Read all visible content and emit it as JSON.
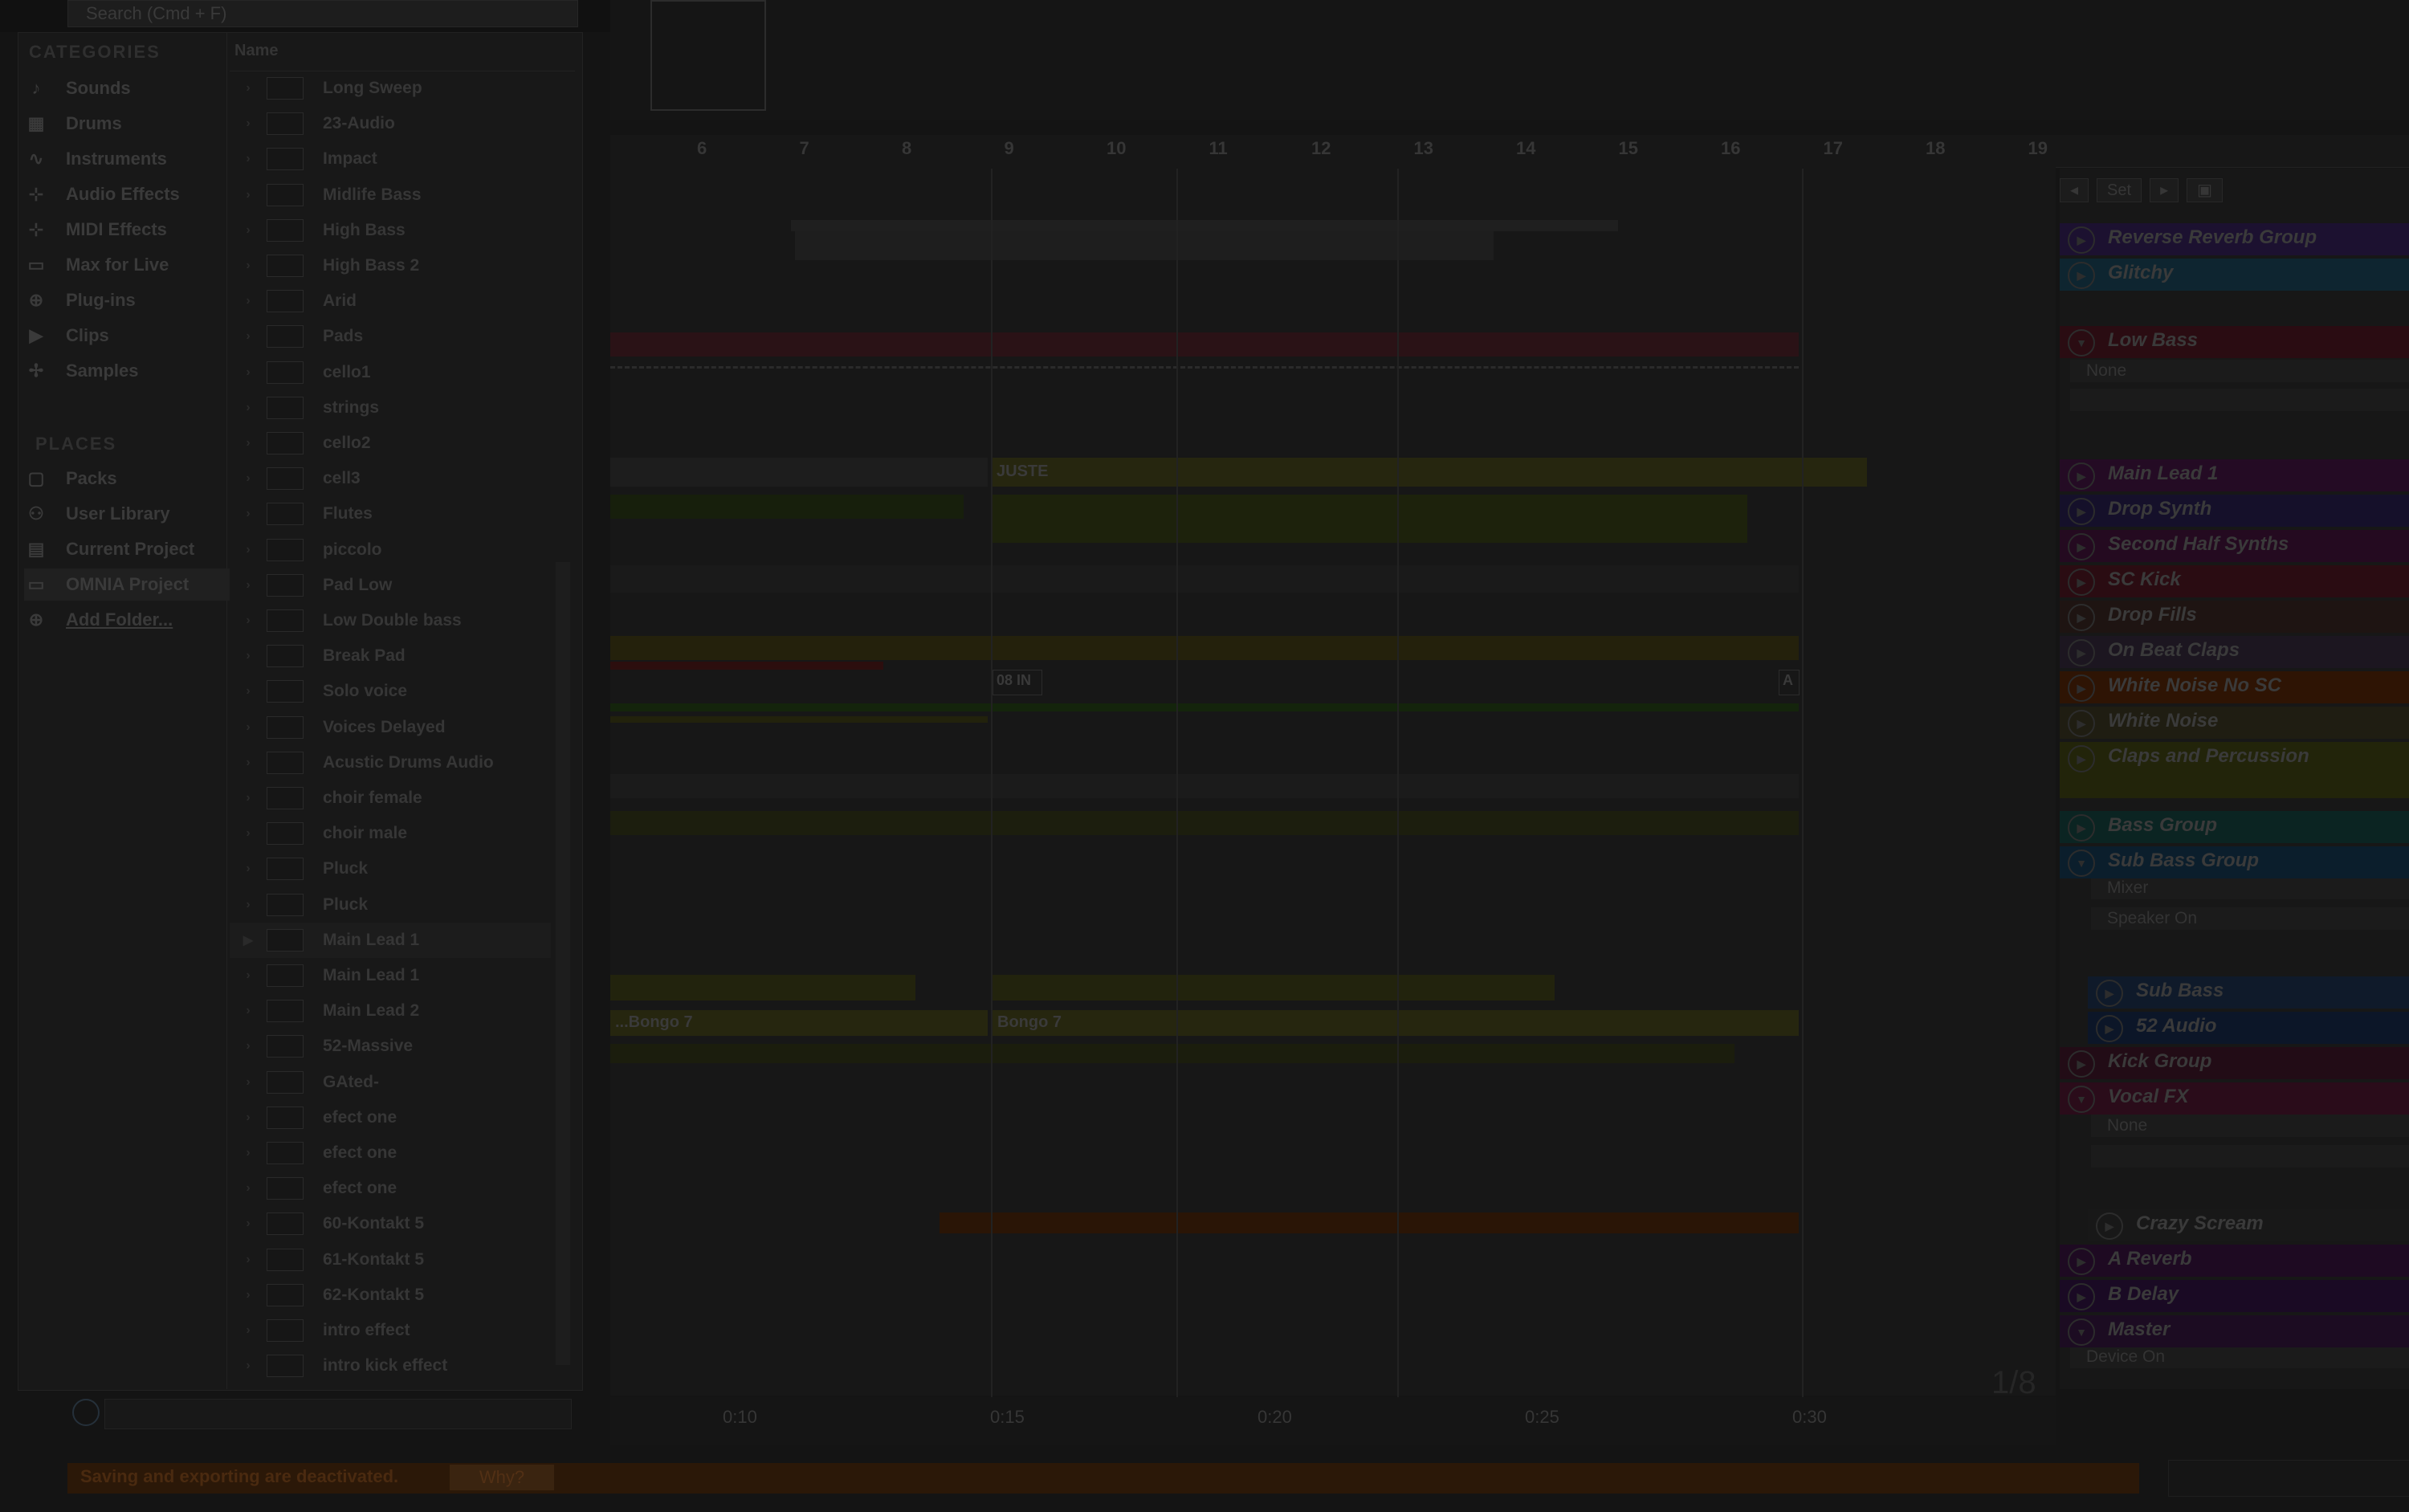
{
  "search": {
    "placeholder": "Search (Cmd + F)"
  },
  "browser": {
    "categories_title": "CATEGORIES",
    "categories": [
      {
        "label": "Sounds",
        "icon": "note-icon"
      },
      {
        "label": "Drums",
        "icon": "grid-icon"
      },
      {
        "label": "Instruments",
        "icon": "instrument-icon"
      },
      {
        "label": "Audio Effects",
        "icon": "audio-fx-icon"
      },
      {
        "label": "MIDI Effects",
        "icon": "midi-fx-icon"
      },
      {
        "label": "Max for Live",
        "icon": "max-icon"
      },
      {
        "label": "Plug-ins",
        "icon": "plugin-icon"
      },
      {
        "label": "Clips",
        "icon": "clip-icon"
      },
      {
        "label": "Samples",
        "icon": "sample-icon"
      }
    ],
    "places_title": "PLACES",
    "places": [
      {
        "label": "Packs",
        "icon": "packs-icon"
      },
      {
        "label": "User Library",
        "icon": "user-icon"
      },
      {
        "label": "Current Project",
        "icon": "project-icon"
      },
      {
        "label": "OMNIA Project",
        "icon": "folder-icon"
      },
      {
        "label": "Add Folder...",
        "icon": "add-icon"
      }
    ],
    "name_header": "Name",
    "files": [
      "Long Sweep",
      "23-Audio",
      "Impact",
      "Midlife Bass",
      "High Bass",
      "High Bass 2",
      "Arid",
      "Pads",
      "cello1",
      "strings",
      "cello2",
      "cell3",
      "Flutes",
      "piccolo",
      "Pad Low",
      "Low Double bass",
      "Break Pad",
      "Solo voice",
      "Voices Delayed",
      "Acustic Drums Audio",
      "choir female",
      "choir male",
      "Pluck",
      "Pluck",
      "Main Lead 1",
      "Main Lead 1",
      "Main Lead 2",
      "52-Massive",
      "GAted-",
      "efect one",
      "efect one",
      "efect one",
      "60-Kontakt 5",
      "61-Kontakt 5",
      "62-Kontakt 5",
      "intro effect",
      "intro kick effect"
    ]
  },
  "ruler": {
    "bars": [
      "6",
      "7",
      "8",
      "9",
      "10",
      "11",
      "12",
      "13",
      "14",
      "15",
      "16",
      "17",
      "18",
      "19"
    ]
  },
  "timeline": {
    "times": [
      "0:10",
      "0:15",
      "0:20",
      "0:25",
      "0:30"
    ],
    "zoom": "1/8"
  },
  "clips": {
    "juste": "JUSTE",
    "bongo_a": "...Bongo 7",
    "bongo_b": "Bongo 7",
    "in_label": "08 IN",
    "a_label": "A"
  },
  "set_controls": {
    "set_label": "Set"
  },
  "tracks": [
    {
      "name": "Reverse Reverb Group",
      "color": "#1c1130",
      "fold": "closed"
    },
    {
      "name": "Glitchy",
      "color": "#0e2530",
      "fold": "closed"
    },
    {
      "name": "Low Bass",
      "color": "#2a0c12",
      "fold": "open"
    },
    {
      "name": "Main Lead 1",
      "color": "#240b24",
      "fold": "closed"
    },
    {
      "name": "Drop Synth",
      "color": "#15102a",
      "fold": "closed"
    },
    {
      "name": "Second Half Synths",
      "color": "#240a20",
      "fold": "closed"
    },
    {
      "name": "SC Kick",
      "color": "#2a0c12",
      "fold": "closed"
    },
    {
      "name": "Drop Fills",
      "color": "#1e1412",
      "fold": "closed"
    },
    {
      "name": "On Beat Claps",
      "color": "#1c1620",
      "fold": "closed"
    },
    {
      "name": "White Noise No SC",
      "color": "#2e1404",
      "fold": "closed"
    },
    {
      "name": "White Noise",
      "color": "#1f1d12",
      "fold": "closed"
    },
    {
      "name": "Claps and Percussion",
      "color": "#22240a",
      "fold": "closed"
    },
    {
      "name": "Bass Group",
      "color": "#0b2422",
      "fold": "closed"
    },
    {
      "name": "Sub Bass Group",
      "color": "#0b1e2c",
      "fold": "open"
    },
    {
      "name": "Sub Bass",
      "color": "#0f1a2a",
      "fold": "closed"
    },
    {
      "name": "52 Audio",
      "color": "#0c1628",
      "fold": "closed"
    },
    {
      "name": "Kick Group",
      "color": "#220c16",
      "fold": "closed"
    },
    {
      "name": "Vocal FX",
      "color": "#2a0c1a",
      "fold": "open"
    },
    {
      "name": "Crazy Scream",
      "color": "#181818",
      "fold": "closed"
    },
    {
      "name": "A Reverb",
      "color": "#1e0a22",
      "fold": "closed"
    },
    {
      "name": "B Delay",
      "color": "#1a0a24",
      "fold": "closed"
    },
    {
      "name": "Master",
      "color": "#1c0c22",
      "fold": "open"
    }
  ],
  "device_fields": {
    "low_bass_chain": "None",
    "sub_bass_mixer": "Mixer",
    "sub_bass_speaker": "Speaker On",
    "vocal_fx_chain": "None",
    "master_device": "Device On"
  },
  "status": {
    "message": "Saving and exporting are deactivated.",
    "why": "Why?"
  }
}
